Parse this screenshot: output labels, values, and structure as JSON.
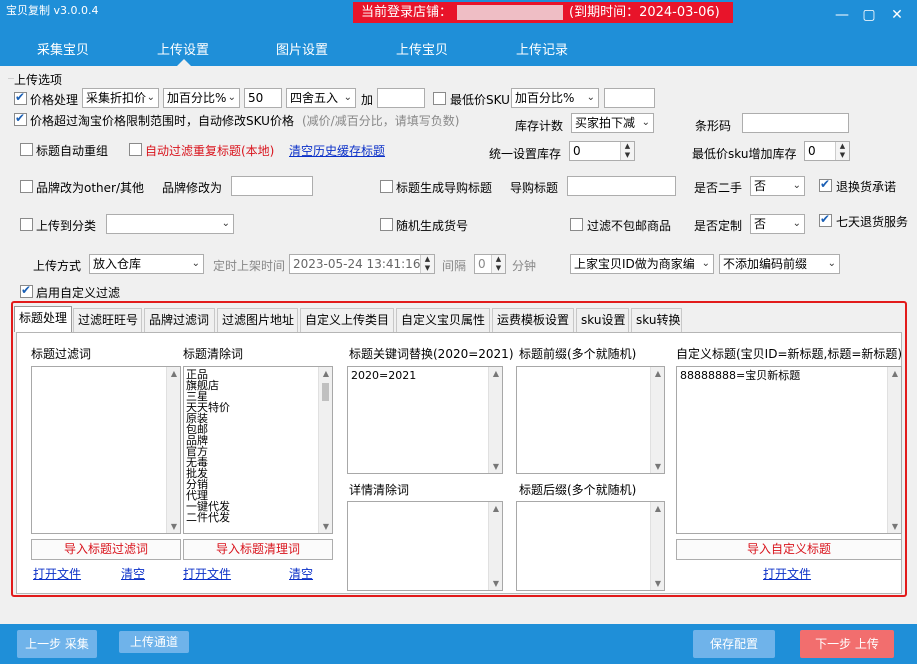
{
  "window": {
    "title": "宝贝复制 v3.0.0.4",
    "shop_label": "当前登录店铺：",
    "expiry": "(到期时间：2024-03-06)",
    "minimize": "—",
    "maximize": "▢",
    "close": "✕"
  },
  "nav": [
    "采集宝贝",
    "上传设置",
    "图片设置",
    "上传宝贝",
    "上传记录"
  ],
  "upload_options": {
    "group_title": "上传选项",
    "price_process": {
      "label": "价格处理",
      "mode": "采集折扣价",
      "calc": "加百分比%",
      "value": "50",
      "round": "四舍五入",
      "plus_label": "加",
      "plus_value": ""
    },
    "min_price": {
      "label": "最低价SKU",
      "calc": "加百分比%",
      "value": ""
    },
    "over_limit": {
      "label": "价格超过淘宝价格限制范围时，自动修改SKU价格",
      "hint": "(减价/减百分比，请填写负数)"
    },
    "stock_count": {
      "label": "库存计数",
      "value": "买家拍下减"
    },
    "barcode": {
      "label": "条形码",
      "value": ""
    },
    "title_reorder": "标题自动重组",
    "auto_filter_dup": "自动过滤重复标题(本地)",
    "clear_history": "清空历史缓存标题",
    "unified_stock": {
      "label": "统一设置库存",
      "value": "0"
    },
    "min_sku_stock": {
      "label": "最低价sku增加库存",
      "value": "0"
    },
    "brand_other": "品牌改为other/其他",
    "brand_change": {
      "label": "品牌修改为",
      "value": ""
    },
    "gen_guide_title": "标题生成导购标题",
    "guide_title": {
      "label": "导购标题",
      "value": ""
    },
    "second_hand": {
      "label": "是否二手",
      "value": "否"
    },
    "return_promise": "退换货承诺",
    "upload_category": {
      "label": "上传到分类",
      "value": ""
    },
    "random_item_no": "随机生成货号",
    "filter_no_free": "过滤不包邮商品",
    "custom_made": {
      "label": "是否定制",
      "value": "否"
    },
    "seven_day": "七天退货服务",
    "upload_method": {
      "label": "上传方式",
      "value": "放入仓库"
    },
    "schedule": {
      "label": "定时上架时间",
      "value": "2023-05-24 13:41:16",
      "interval_label": "间隔",
      "interval": "0",
      "unit": "分钟"
    },
    "merchant_code": "上家宝贝ID做为商家编",
    "code_prefix": "不添加编码前缀",
    "enable_custom_filter": "启用自定义过滤"
  },
  "tabs": [
    "标题处理",
    "过滤旺旺号",
    "品牌过滤词",
    "过滤图片地址",
    "自定义上传类目",
    "自定义宝贝属性",
    "运费模板设置",
    "sku设置",
    "sku转换"
  ],
  "title_tab": {
    "filter_words": {
      "label": "标题过滤词",
      "import": "导入标题过滤词",
      "open": "打开文件",
      "clear": "清空"
    },
    "clear_words": {
      "label": "标题清除词",
      "items": [
        "正品",
        "旗舰店",
        "三星",
        "天天特价",
        "原装",
        "包邮",
        "品牌",
        "官方",
        "无毒",
        "批发",
        "分销",
        "代理",
        "一键代发",
        "二件代发"
      ],
      "import": "导入标题清理词",
      "open": "打开文件",
      "clear": "清空"
    },
    "keyword_replace": {
      "label": "标题关键词替换(2020=2021)",
      "value": "2020=2021"
    },
    "detail_clear": {
      "label": "详情清除词"
    },
    "prefix": {
      "label": "标题前缀(多个就随机)"
    },
    "suffix": {
      "label": "标题后缀(多个就随机)"
    },
    "custom_title": {
      "label": "自定义标题(宝贝ID=新标题,标题=新标题)",
      "value": "88888888=宝贝新标题",
      "import": "导入自定义标题",
      "open": "打开文件"
    }
  },
  "footer": {
    "prev": "上一步 采集",
    "channel": "上传通道",
    "save": "保存配置",
    "next": "下一步 上传"
  },
  "colors": {
    "title_bg": "#1f8fd8",
    "banner": "#e8142a",
    "panel_border": "#e21b1b",
    "next_btn": "#f26e6e",
    "btn_light": "#6fb3ea"
  }
}
